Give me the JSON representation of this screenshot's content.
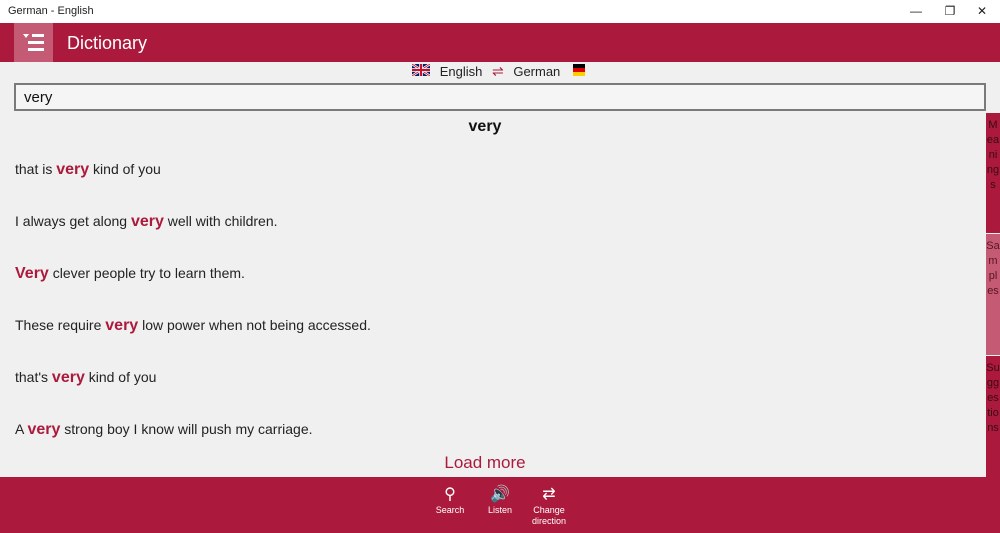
{
  "window": {
    "title": "German - English",
    "controls": [
      "minimize",
      "restore",
      "close"
    ]
  },
  "header": {
    "title": "Dictionary",
    "menu_icon": "hamburger-menu-icon"
  },
  "language": {
    "from": "English",
    "to": "German",
    "swap_icon": "swap-arrows-icon"
  },
  "search": {
    "value": "very"
  },
  "result": {
    "word": "very",
    "samples": [
      {
        "before": "that is ",
        "hl": "very",
        "after": " kind of you"
      },
      {
        "before": "I always get along ",
        "hl": "very",
        "after": " well with children."
      },
      {
        "before": "",
        "hl": "Very",
        "after": " clever people try to learn them."
      },
      {
        "before": "These require ",
        "hl": "very",
        "after": " low power when not being accessed."
      },
      {
        "before": "that's ",
        "hl": "very",
        "after": " kind of you"
      },
      {
        "before": "A ",
        "hl": "very",
        "after": " strong boy I know will push my carriage."
      }
    ],
    "load_more": "Load more"
  },
  "side_tabs": [
    {
      "label": "Meanings",
      "active": false
    },
    {
      "label": "Samples",
      "active": true
    },
    {
      "label": "Suggestions",
      "active": false
    }
  ],
  "bottom": {
    "search": "Search",
    "listen": "Listen",
    "change": "Change direction"
  },
  "colors": {
    "accent": "#ab1a3c",
    "tab_active": "#c45a73"
  }
}
